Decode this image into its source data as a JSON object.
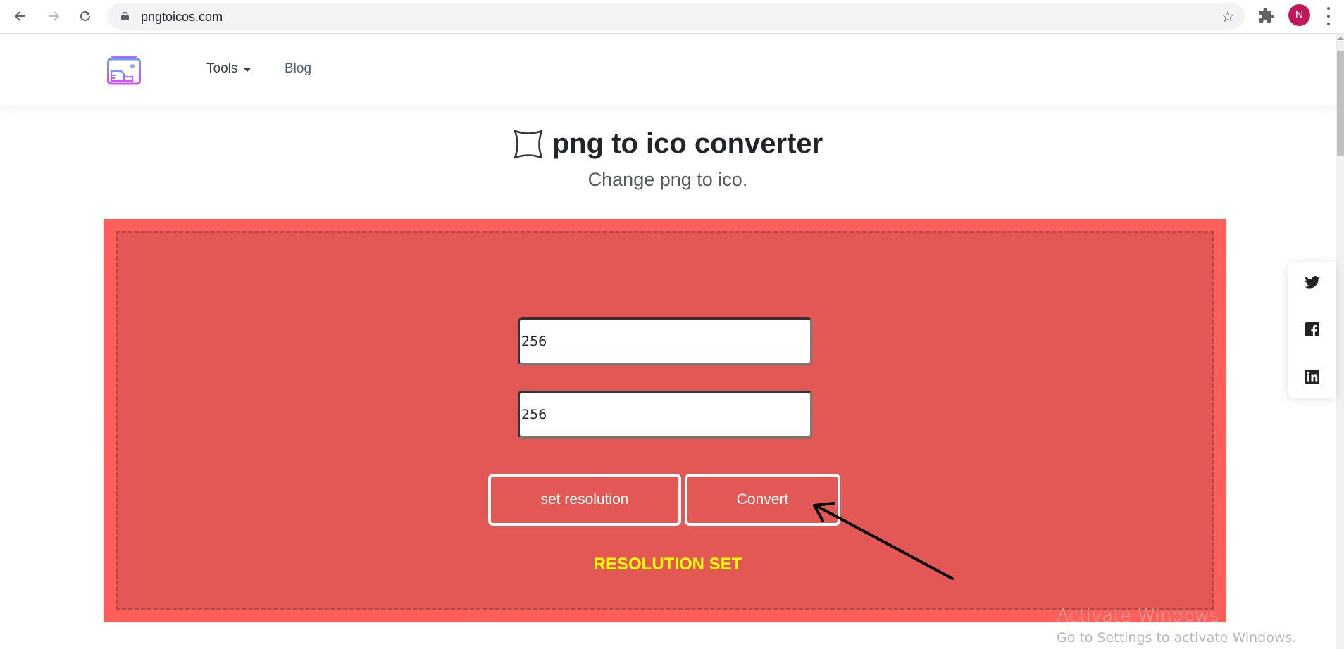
{
  "browser": {
    "url": "pngtoicos.com",
    "profile_initial": "N",
    "profile_color": "#c2185b",
    "icons": [
      "back-icon",
      "forward-icon",
      "reload-icon",
      "lock-icon",
      "bookmark-star-icon",
      "extensions-icon",
      "menu-icon"
    ]
  },
  "header": {
    "nav": [
      {
        "label": "Tools",
        "has_dropdown": true
      },
      {
        "label": "Blog"
      }
    ]
  },
  "hero": {
    "title": "png to ico converter",
    "subtitle": "Change png to ico."
  },
  "converter": {
    "width_value": "256",
    "height_value": "256",
    "set_resolution_label": "set resolution",
    "convert_label": "Convert",
    "status_text": "RESOLUTION SET",
    "colors": {
      "outer": "#ff5f5a",
      "inner": "#e35854",
      "status": "#ffff00"
    }
  },
  "social": [
    "twitter-icon",
    "facebook-icon",
    "linkedin-icon"
  ],
  "watermark": {
    "line1": "Activate Windows",
    "line2": "Go to Settings to activate Windows."
  }
}
